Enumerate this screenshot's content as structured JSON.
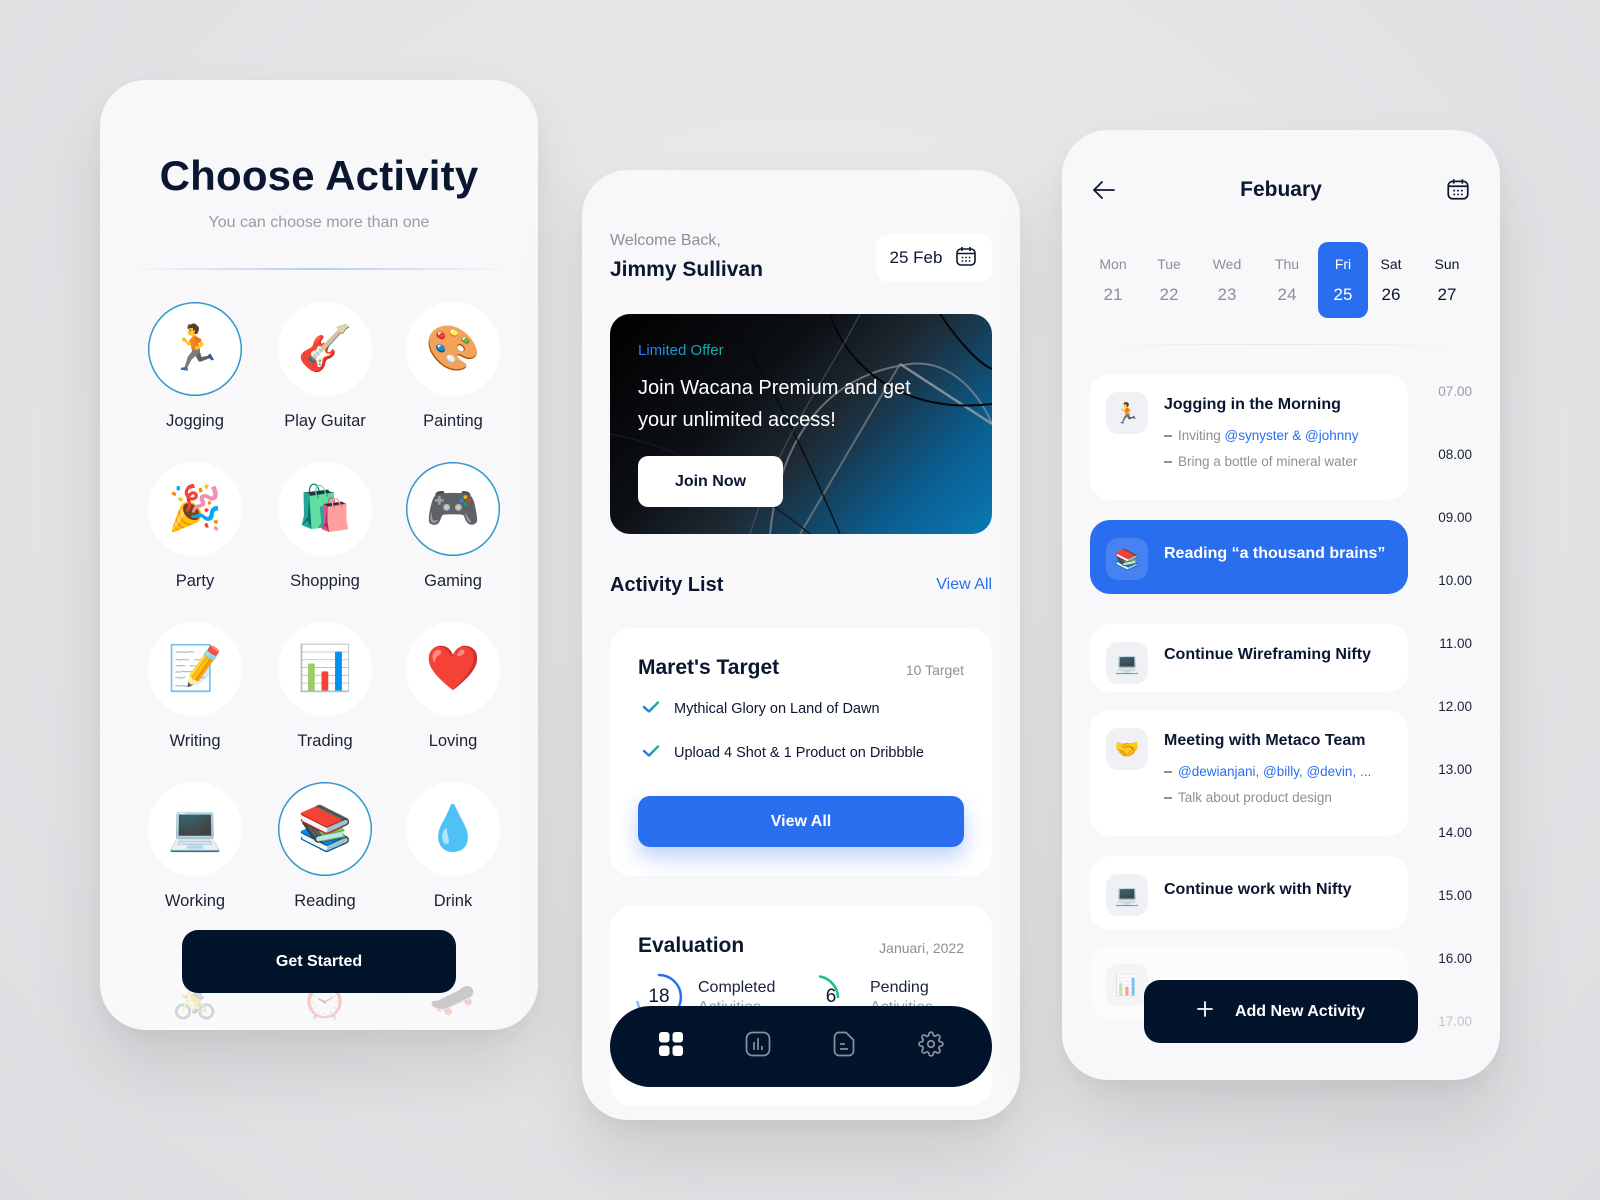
{
  "screen1": {
    "title": "Choose Activity",
    "subtitle": "You can choose more than one",
    "activities": [
      {
        "label": "Jogging",
        "icon": "🏃",
        "icon_name": "runner-icon",
        "selected": true
      },
      {
        "label": "Play Guitar",
        "icon": "🎸",
        "icon_name": "guitar-icon",
        "selected": false
      },
      {
        "label": "Painting",
        "icon": "🎨",
        "icon_name": "palette-icon",
        "selected": false
      },
      {
        "label": "Party",
        "icon": "🎉",
        "icon_name": "party-popper-icon",
        "selected": false
      },
      {
        "label": "Shopping",
        "icon": "🛍️",
        "icon_name": "shopping-bags-icon",
        "selected": false
      },
      {
        "label": "Gaming",
        "icon": "🎮",
        "icon_name": "game-controller-icon",
        "selected": true
      },
      {
        "label": "Writing",
        "icon": "📝",
        "icon_name": "memo-pencil-icon",
        "selected": false
      },
      {
        "label": "Trading",
        "icon": "📊",
        "icon_name": "bar-chart-icon",
        "selected": false
      },
      {
        "label": "Loving",
        "icon": "❤️",
        "icon_name": "heart-icon",
        "selected": false
      },
      {
        "label": "Working",
        "icon": "💻",
        "icon_name": "laptop-icon",
        "selected": false
      },
      {
        "label": "Reading",
        "icon": "📚",
        "icon_name": "books-icon",
        "selected": true
      },
      {
        "label": "Drink",
        "icon": "💧",
        "icon_name": "droplet-icon",
        "selected": false
      }
    ],
    "faded_row_icons": [
      "🚴",
      "⏰",
      "🛹"
    ],
    "get_started_label": "Get Started"
  },
  "screen2": {
    "welcome": "Welcome Back,",
    "username": "Jimmy Sullivan",
    "date": "25 Feb",
    "banner": {
      "tag": "Limited Offer",
      "headline": "Join Wacana Premium and get your unlimited access!",
      "button": "Join Now"
    },
    "activity_list": {
      "title": "Activity List",
      "view_all": "View All"
    },
    "target_card": {
      "title": "Maret's Target",
      "count": "10 Target",
      "items": [
        "Mythical Glory on Land of Dawn",
        "Upload 4 Shot & 1 Product on Dribbble"
      ],
      "button": "View All"
    },
    "evaluation": {
      "title": "Evaluation",
      "period": "Januari, 2022",
      "completed": {
        "value": "18",
        "label": "Completed",
        "sub": "Activities",
        "color": "#2a6ef0"
      },
      "pending": {
        "value": "6",
        "label": "Pending",
        "sub": "Activities",
        "color": "#16c08a"
      }
    },
    "nav": [
      "dashboard",
      "statistics",
      "documents",
      "settings"
    ]
  },
  "screen3": {
    "month": "Febuary",
    "week": [
      {
        "day": "Mon",
        "date": "21",
        "active": false,
        "weekend": false
      },
      {
        "day": "Tue",
        "date": "22",
        "active": false,
        "weekend": false
      },
      {
        "day": "Wed",
        "date": "23",
        "active": false,
        "weekend": false
      },
      {
        "day": "Thu",
        "date": "24",
        "active": false,
        "weekend": false
      },
      {
        "day": "Fri",
        "date": "25",
        "active": true,
        "weekend": false
      },
      {
        "day": "Sat",
        "date": "26",
        "active": false,
        "weekend": true
      },
      {
        "day": "Sun",
        "date": "27",
        "active": false,
        "weekend": true
      }
    ],
    "times": [
      "07.00",
      "08.00",
      "09.00",
      "10.00",
      "11.00",
      "12.00",
      "13.00",
      "14.00",
      "15.00",
      "16.00",
      "17.00"
    ],
    "events": [
      {
        "title": "Jogging in the Morning",
        "icon": "🏃",
        "icon_name": "runner-icon",
        "note1_prefix": "Inviting ",
        "note1_mentions": "@synyster & @johnny",
        "note2": "Bring a bottle of mineral water",
        "active": false
      },
      {
        "title": "Reading “a thousand brains”",
        "icon": "📚",
        "icon_name": "books-icon",
        "active": true
      },
      {
        "title": "Continue Wireframing Nifty",
        "icon": "💻",
        "icon_name": "laptop-icon",
        "active": false
      },
      {
        "title": "Meeting with Metaco Team",
        "icon": "🤝",
        "icon_name": "handshake-icon",
        "note1_prefix": "",
        "note1_mentions": "@dewianjani, @billy, @devin, ...",
        "note2": "Talk about product design",
        "active": false
      },
      {
        "title": "Continue work with Nifty",
        "icon": "💻",
        "icon_name": "laptop-icon",
        "active": false
      },
      {
        "title": "",
        "icon": "📊",
        "icon_name": "bar-chart-icon",
        "active": false
      }
    ],
    "add_button": "Add New Activity"
  }
}
